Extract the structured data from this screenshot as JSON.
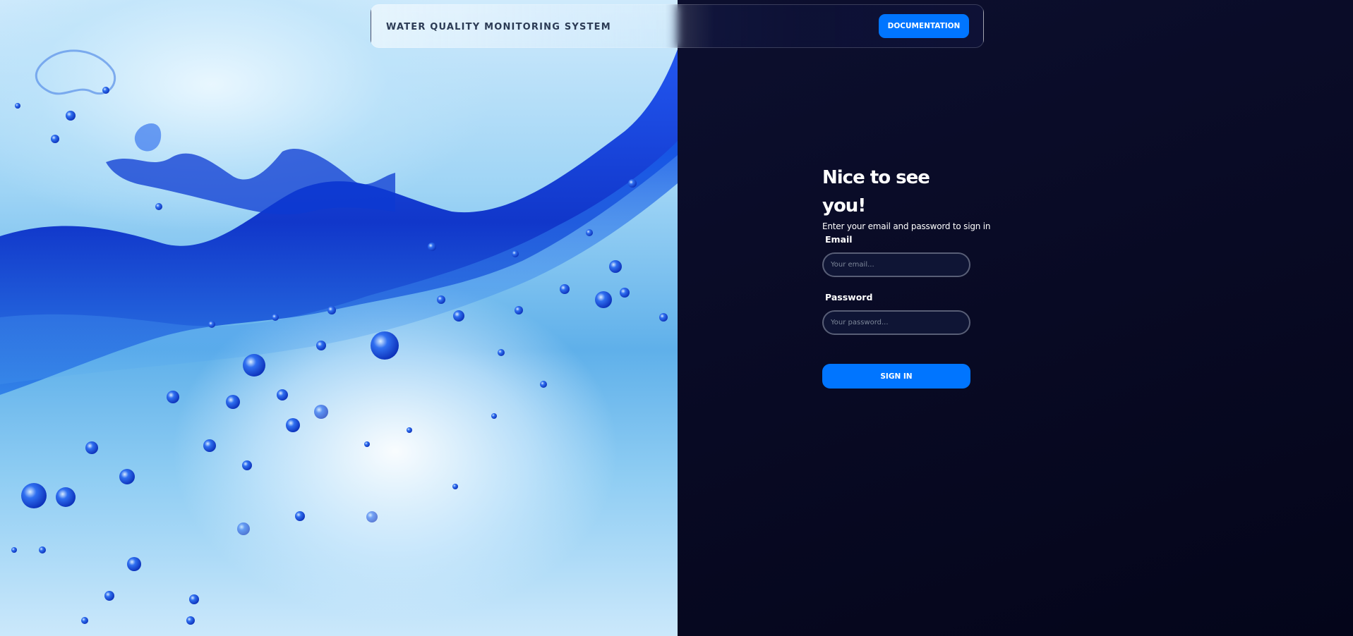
{
  "header": {
    "title": "WATER QUALITY MONITORING SYSTEM",
    "documentation_label": "DOCUMENTATION"
  },
  "signin": {
    "heading": "Nice to see you!",
    "subheading": "Enter your email and password to sign in",
    "email_label": "Email",
    "email_placeholder": "Your email...",
    "password_label": "Password",
    "password_placeholder": "Your password...",
    "submit_label": "SIGN IN"
  },
  "colors": {
    "accent": "#0075ff",
    "background_dark": "#0a0c28",
    "water_blue": "#0a3bd6"
  },
  "illustration": {
    "subject": "blue water splash with bubbles"
  }
}
